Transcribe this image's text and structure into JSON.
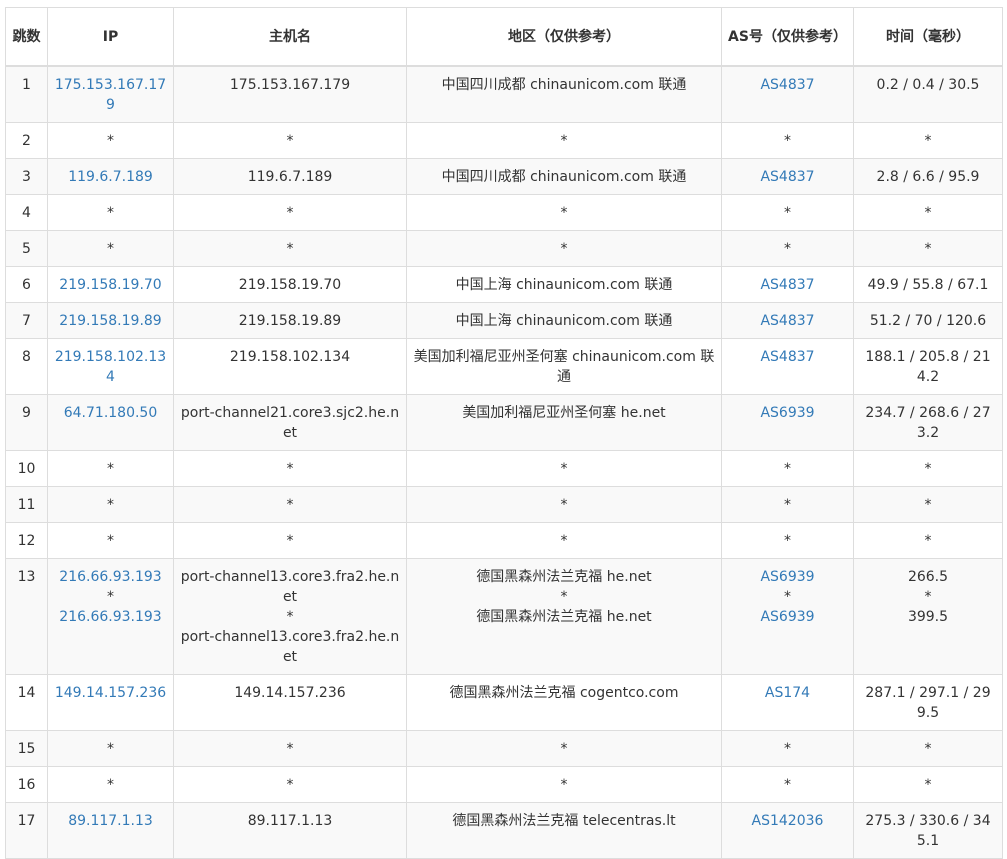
{
  "headers": {
    "hop": "跳数",
    "ip": "IP",
    "host": "主机名",
    "region": "地区（仅供参考）",
    "as": "AS号（仅供参考）",
    "time": "时间（毫秒）"
  },
  "rows": [
    {
      "hop": "1",
      "ip": [
        "175.153.167.179"
      ],
      "host": [
        "175.153.167.179"
      ],
      "region": [
        "中国四川成都 chinaunicom.com 联通"
      ],
      "as": [
        "AS4837"
      ],
      "time": [
        "0.2 / 0.4 / 30.5"
      ]
    },
    {
      "hop": "2",
      "ip": [
        "*"
      ],
      "host": [
        "*"
      ],
      "region": [
        "*"
      ],
      "as": [
        "*"
      ],
      "time": [
        "*"
      ]
    },
    {
      "hop": "3",
      "ip": [
        "119.6.7.189"
      ],
      "host": [
        "119.6.7.189"
      ],
      "region": [
        "中国四川成都 chinaunicom.com 联通"
      ],
      "as": [
        "AS4837"
      ],
      "time": [
        "2.8 / 6.6 / 95.9"
      ]
    },
    {
      "hop": "4",
      "ip": [
        "*"
      ],
      "host": [
        "*"
      ],
      "region": [
        "*"
      ],
      "as": [
        "*"
      ],
      "time": [
        "*"
      ]
    },
    {
      "hop": "5",
      "ip": [
        "*"
      ],
      "host": [
        "*"
      ],
      "region": [
        "*"
      ],
      "as": [
        "*"
      ],
      "time": [
        "*"
      ]
    },
    {
      "hop": "6",
      "ip": [
        "219.158.19.70"
      ],
      "host": [
        "219.158.19.70"
      ],
      "region": [
        "中国上海 chinaunicom.com 联通"
      ],
      "as": [
        "AS4837"
      ],
      "time": [
        "49.9 / 55.8 / 67.1"
      ]
    },
    {
      "hop": "7",
      "ip": [
        "219.158.19.89"
      ],
      "host": [
        "219.158.19.89"
      ],
      "region": [
        "中国上海 chinaunicom.com 联通"
      ],
      "as": [
        "AS4837"
      ],
      "time": [
        "51.2 / 70 / 120.6"
      ]
    },
    {
      "hop": "8",
      "ip": [
        "219.158.102.134"
      ],
      "host": [
        "219.158.102.134"
      ],
      "region": [
        "美国加利福尼亚州圣何塞 chinaunicom.com 联通"
      ],
      "as": [
        "AS4837"
      ],
      "time": [
        "188.1 / 205.8 / 214.2"
      ]
    },
    {
      "hop": "9",
      "ip": [
        "64.71.180.50"
      ],
      "host": [
        "port-channel21.core3.sjc2.he.net"
      ],
      "region": [
        "美国加利福尼亚州圣何塞 he.net"
      ],
      "as": [
        "AS6939"
      ],
      "time": [
        "234.7 / 268.6 / 273.2"
      ]
    },
    {
      "hop": "10",
      "ip": [
        "*"
      ],
      "host": [
        "*"
      ],
      "region": [
        "*"
      ],
      "as": [
        "*"
      ],
      "time": [
        "*"
      ]
    },
    {
      "hop": "11",
      "ip": [
        "*"
      ],
      "host": [
        "*"
      ],
      "region": [
        "*"
      ],
      "as": [
        "*"
      ],
      "time": [
        "*"
      ]
    },
    {
      "hop": "12",
      "ip": [
        "*"
      ],
      "host": [
        "*"
      ],
      "region": [
        "*"
      ],
      "as": [
        "*"
      ],
      "time": [
        "*"
      ]
    },
    {
      "hop": "13",
      "ip": [
        "216.66.93.193",
        "*",
        "216.66.93.193"
      ],
      "host": [
        "port-channel13.core3.fra2.he.net",
        "*",
        "port-channel13.core3.fra2.he.net"
      ],
      "region": [
        "德国黑森州法兰克福 he.net",
        "*",
        "德国黑森州法兰克福 he.net"
      ],
      "as": [
        "AS6939",
        "*",
        "AS6939"
      ],
      "time": [
        "266.5",
        "*",
        "399.5"
      ]
    },
    {
      "hop": "14",
      "ip": [
        "149.14.157.236"
      ],
      "host": [
        "149.14.157.236"
      ],
      "region": [
        "德国黑森州法兰克福 cogentco.com"
      ],
      "as": [
        "AS174"
      ],
      "time": [
        "287.1 / 297.1 / 299.5"
      ]
    },
    {
      "hop": "15",
      "ip": [
        "*"
      ],
      "host": [
        "*"
      ],
      "region": [
        "*"
      ],
      "as": [
        "*"
      ],
      "time": [
        "*"
      ]
    },
    {
      "hop": "16",
      "ip": [
        "*"
      ],
      "host": [
        "*"
      ],
      "region": [
        "*"
      ],
      "as": [
        "*"
      ],
      "time": [
        "*"
      ]
    },
    {
      "hop": "17",
      "ip": [
        "89.117.1.13"
      ],
      "host": [
        "89.117.1.13"
      ],
      "region": [
        "德国黑森州法兰克福 telecentras.lt"
      ],
      "as": [
        "AS142036"
      ],
      "time": [
        "275.3 / 330.6 / 345.1"
      ]
    }
  ],
  "colors": {
    "link": "#337ab7",
    "border": "#dddddd",
    "stripe": "#f9f9f9",
    "text": "#333333"
  }
}
